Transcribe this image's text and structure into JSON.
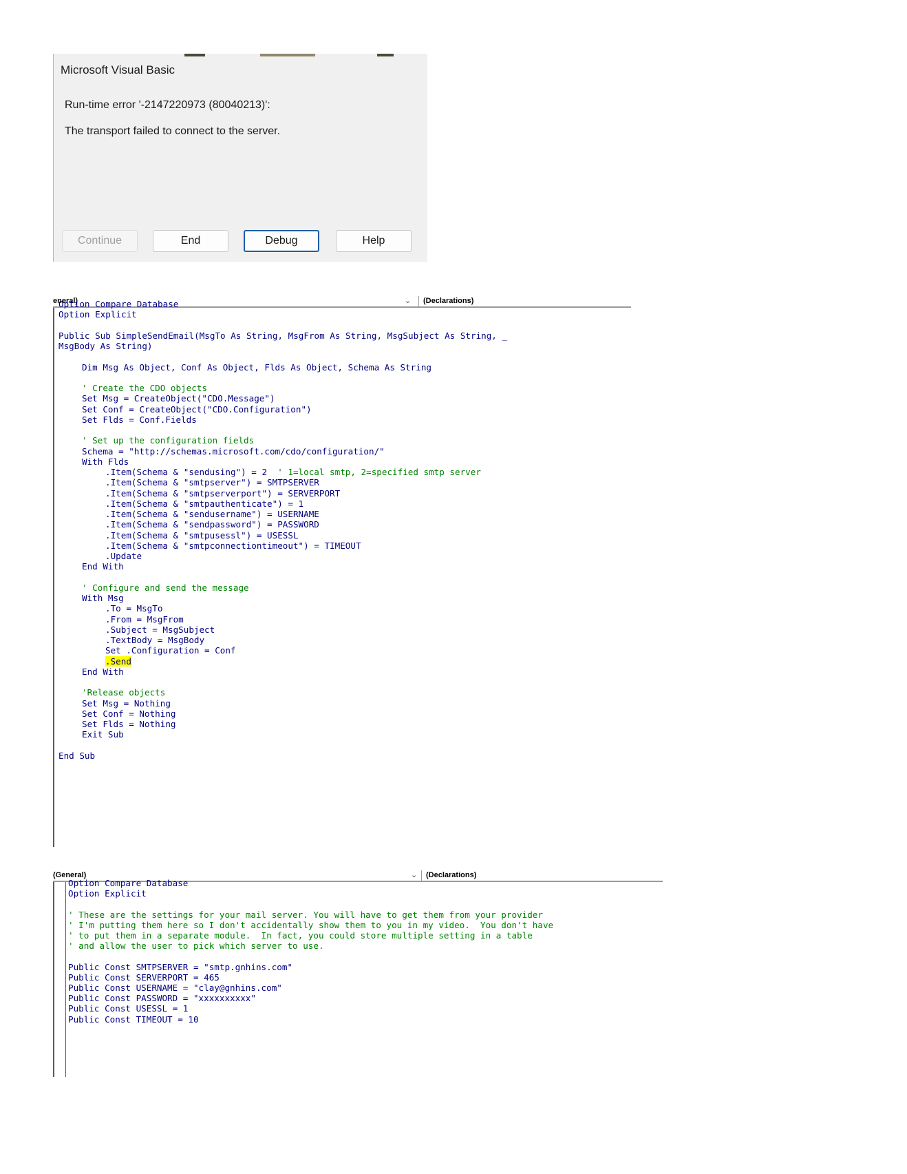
{
  "dialog": {
    "title": "Microsoft Visual Basic",
    "error": "Run-time error '-2147220973 (80040213)':",
    "message": "The transport failed to connect to the server.",
    "buttons": [
      "Continue",
      "End",
      "Debug",
      "Help"
    ],
    "disabled_button": "Continue",
    "default_button": "Debug"
  },
  "editor1": {
    "object_combo": "eneral)",
    "proc_combo": "(Declarations)",
    "lines": [
      {
        "t": "Option Compare Database",
        "i": 0
      },
      {
        "t": "Option Explicit",
        "i": 0
      },
      {
        "t": "",
        "i": 0
      },
      {
        "t": "Public Sub SimpleSendEmail(MsgTo As String, MsgFrom As String, MsgSubject As String, _",
        "i": 0
      },
      {
        "t": "MsgBody As String)",
        "i": 0
      },
      {
        "t": "",
        "i": 0
      },
      {
        "t": "Dim Msg As Object, Conf As Object, Flds As Object, Schema As String",
        "i": 1
      },
      {
        "t": "",
        "i": 0
      },
      {
        "t": "' Create the CDO objects",
        "i": 1,
        "c": 1
      },
      {
        "t": "Set Msg = CreateObject(\"CDO.Message\")",
        "i": 1
      },
      {
        "t": "Set Conf = CreateObject(\"CDO.Configuration\")",
        "i": 1
      },
      {
        "t": "Set Flds = Conf.Fields",
        "i": 1
      },
      {
        "t": "",
        "i": 0
      },
      {
        "t": "' Set up the configuration fields",
        "i": 1,
        "c": 1
      },
      {
        "t": "Schema = \"http://schemas.microsoft.com/cdo/configuration/\"",
        "i": 1
      },
      {
        "t": "With Flds",
        "i": 1
      },
      {
        "t": ".Item(Schema & \"sendusing\") = 2  ",
        "i": 2,
        "tc": "' 1=local smtp, 2=specified smtp server"
      },
      {
        "t": ".Item(Schema & \"smtpserver\") = SMTPSERVER",
        "i": 2
      },
      {
        "t": ".Item(Schema & \"smtpserverport\") = SERVERPORT",
        "i": 2
      },
      {
        "t": ".Item(Schema & \"smtpauthenticate\") = 1",
        "i": 2
      },
      {
        "t": ".Item(Schema & \"sendusername\") = USERNAME",
        "i": 2
      },
      {
        "t": ".Item(Schema & \"sendpassword\") = PASSWORD",
        "i": 2
      },
      {
        "t": ".Item(Schema & \"smtpusessl\") = USESSL",
        "i": 2
      },
      {
        "t": ".Item(Schema & \"smtpconnectiontimeout\") = TIMEOUT",
        "i": 2
      },
      {
        "t": ".Update",
        "i": 2
      },
      {
        "t": "End With",
        "i": 1
      },
      {
        "t": "",
        "i": 0
      },
      {
        "t": "' Configure and send the message",
        "i": 1,
        "c": 1
      },
      {
        "t": "With Msg",
        "i": 1
      },
      {
        "t": ".To = MsgTo",
        "i": 2
      },
      {
        "t": ".From = MsgFrom",
        "i": 2
      },
      {
        "t": ".Subject = MsgSubject",
        "i": 2
      },
      {
        "t": ".TextBody = MsgBody",
        "i": 2
      },
      {
        "t": "Set .Configuration = Conf",
        "i": 2
      },
      {
        "t": ".Send",
        "i": 2,
        "hl": 1
      },
      {
        "t": "End With",
        "i": 1
      },
      {
        "t": "",
        "i": 0
      },
      {
        "t": "'Release objects",
        "i": 1,
        "c": 1
      },
      {
        "t": "Set Msg = Nothing",
        "i": 1
      },
      {
        "t": "Set Conf = Nothing",
        "i": 1
      },
      {
        "t": "Set Flds = Nothing",
        "i": 1
      },
      {
        "t": "Exit Sub",
        "i": 1
      },
      {
        "t": "",
        "i": 0
      },
      {
        "t": "End Sub",
        "i": 0
      }
    ]
  },
  "editor2": {
    "object_combo": "(General)",
    "proc_combo": "(Declarations)",
    "lines": [
      {
        "t": "Option Compare Database",
        "i": 0
      },
      {
        "t": "Option Explicit",
        "i": 0
      },
      {
        "t": "",
        "i": 0
      },
      {
        "t": "' These are the settings for your mail server. You will have to get them from your provider",
        "i": 0,
        "c": 1
      },
      {
        "t": "' I'm putting them here so I don't accidentally show them to you in my video.  You don't have",
        "i": 0,
        "c": 1
      },
      {
        "t": "' to put them in a separate module.  In fact, you could store multiple setting in a table",
        "i": 0,
        "c": 1
      },
      {
        "t": "' and allow the user to pick which server to use.",
        "i": 0,
        "c": 1
      },
      {
        "t": "",
        "i": 0
      },
      {
        "t": "Public Const SMTPSERVER = \"smtp.gnhins.com\"",
        "i": 0
      },
      {
        "t": "Public Const SERVERPORT = 465",
        "i": 0
      },
      {
        "t": "Public Const USERNAME = \"clay@gnhins.com\"",
        "i": 0
      },
      {
        "t": "Public Const PASSWORD = \"xxxxxxxxxx\"",
        "i": 0
      },
      {
        "t": "Public Const USESSL = 1",
        "i": 0
      },
      {
        "t": "Public Const TIMEOUT = 10",
        "i": 0
      }
    ]
  },
  "colors": {
    "keyword_text": "#00007f",
    "comment": "#008000",
    "highlight": "#ffff00",
    "debug_button_border": "#1d5ea8"
  }
}
